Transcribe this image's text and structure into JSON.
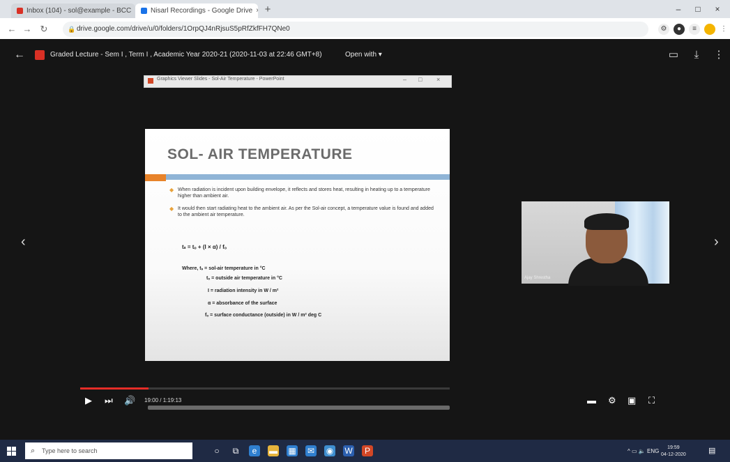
{
  "browser": {
    "tabs": [
      {
        "label": "Inbox (104) - sol@example - BCC",
        "favicon": "gmail-icon",
        "color": "#d93025"
      },
      {
        "label": "Nisarl Recordings - Google Drive",
        "favicon": "drive-icon",
        "color": "#1a73e8"
      }
    ],
    "new_tab_label": "+",
    "window_controls": [
      "–",
      "□",
      "×"
    ],
    "url": "drive.google.com/drive/u/0/folders/1OrpQJ4nRjsuS5pRfZkfFH7QNe0"
  },
  "viewer": {
    "title": "Graded Lecture - Sem I , Term I , Academic Year 2020-21 (2020-11-03 at 22:46 GMT+8)",
    "open_with_label": "Open with ▾",
    "icons": [
      "comment-icon",
      "download-icon",
      "more-icon"
    ]
  },
  "ppt_window": {
    "title": "Graphics Viewer Slides - Sol-Air Temperature - PowerPoint",
    "controls": [
      "–",
      "□",
      "×"
    ]
  },
  "slide": {
    "title": "SOL- AIR TEMPERATURE",
    "bullets": [
      "When radiation is incident upon building envelope, it reflects and stores heat, resulting in heating up to a temperature higher than ambient air.",
      "It would then start radiating heat to the ambient air. As per the Sol-air concept, a temperature value is found and added to the ambient air temperature."
    ],
    "formula": "tₛ = tₒ + (I × α) / fₒ",
    "definitions": [
      "Where, tₛ = sol-air temperature in °C",
      "tₒ = outside air temperature in °C",
      "I = radiation intensity in W / m²",
      "α = absorbance of the surface",
      "fₒ = surface conductance (outside) in W / m² deg C"
    ]
  },
  "webcam": {
    "name_label": "Ajay Shrestha"
  },
  "player": {
    "time": "19:00 / 1:19:13",
    "progress_fraction": 0.185
  },
  "taskbar": {
    "search_placeholder": "Type here to search",
    "apps": [
      {
        "name": "cortana-icon",
        "color": "#1f2a44"
      },
      {
        "name": "task-view-icon",
        "color": "#1f2a44"
      },
      {
        "name": "edge-icon",
        "color": "#2f7fd0"
      },
      {
        "name": "file-explorer-icon",
        "color": "#e6b43c"
      },
      {
        "name": "store-icon",
        "color": "#2f7fd0"
      },
      {
        "name": "mail-icon",
        "color": "#2f7fd0"
      },
      {
        "name": "chrome-icon",
        "color": "#3e8ed0"
      },
      {
        "name": "word-icon",
        "color": "#2b5fb0"
      },
      {
        "name": "powerpoint-icon",
        "color": "#d24726"
      }
    ],
    "tray": "ENG",
    "time": "19:59",
    "date": "04-12-2020"
  }
}
